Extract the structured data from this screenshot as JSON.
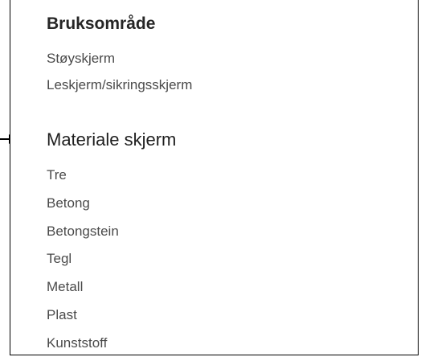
{
  "sections": [
    {
      "title": "Bruksområde",
      "items": [
        "Støyskjerm",
        "Leskjerm/sikringsskjerm"
      ]
    },
    {
      "title": "Materiale skjerm",
      "items": [
        "Tre",
        "Betong",
        "Betongstein",
        "Tegl",
        "Metall",
        "Plast",
        "Kunststoff"
      ]
    }
  ],
  "annotation": {
    "icon": "arrow-right-icon",
    "color": "#000000"
  }
}
